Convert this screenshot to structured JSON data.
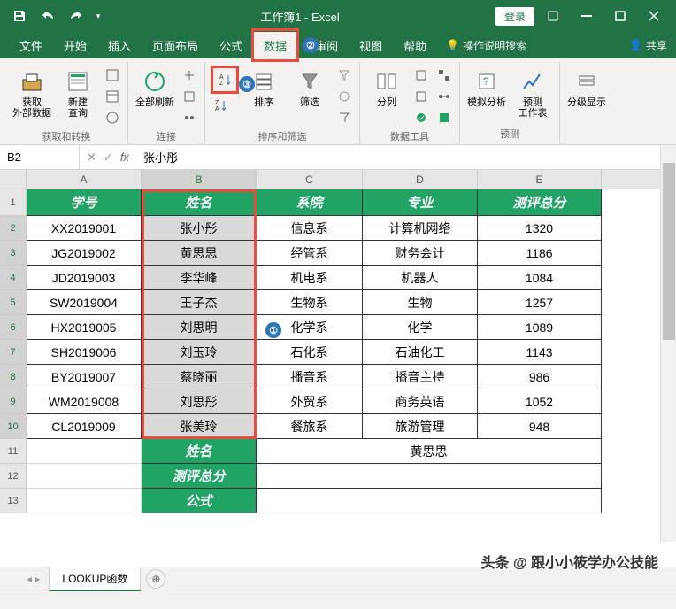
{
  "title": "工作簿1 - Excel",
  "login": "登录",
  "share": "共享",
  "tell_me": "操作说明搜索",
  "tabs": [
    "文件",
    "开始",
    "插入",
    "页面布局",
    "公式",
    "数据",
    "审阅",
    "视图",
    "帮助"
  ],
  "active_tab": 5,
  "annotations": {
    "1": "①",
    "2": "②",
    "3": "③"
  },
  "ribbon_groups": {
    "g1": {
      "btn1": "获取\n外部数据",
      "label": "获取和转换",
      "btn2": "新建\n查询"
    },
    "g2": {
      "btn": "全部刷新",
      "label": "连接"
    },
    "g3": {
      "btn_sort": "排序",
      "btn_filter": "筛选",
      "label": "排序和筛选"
    },
    "g4": {
      "btn": "分列",
      "label": "数据工具"
    },
    "g5": {
      "btn1": "模拟分析",
      "btn2": "预测\n工作表",
      "label": "预测"
    },
    "g6": {
      "btn": "分级显示",
      "label": ""
    }
  },
  "name_box": "B2",
  "formula_value": "张小彤",
  "columns": [
    "A",
    "B",
    "C",
    "D",
    "E"
  ],
  "headers": [
    "学号",
    "姓名",
    "系院",
    "专业",
    "测评总分"
  ],
  "rows": [
    {
      "n": "1"
    },
    {
      "n": "2",
      "d": [
        "XX2019001",
        "张小彤",
        "信息系",
        "计算机网络",
        "1320"
      ]
    },
    {
      "n": "3",
      "d": [
        "JG2019002",
        "黄思思",
        "经管系",
        "财务会计",
        "1186"
      ]
    },
    {
      "n": "4",
      "d": [
        "JD2019003",
        "李华峰",
        "机电系",
        "机器人",
        "1084"
      ]
    },
    {
      "n": "5",
      "d": [
        "SW2019004",
        "王子杰",
        "生物系",
        "生物",
        "1257"
      ]
    },
    {
      "n": "6",
      "d": [
        "HX2019005",
        "刘思明",
        "化学系",
        "化学",
        "1089"
      ]
    },
    {
      "n": "7",
      "d": [
        "SH2019006",
        "刘玉玲",
        "石化系",
        "石油化工",
        "1143"
      ]
    },
    {
      "n": "8",
      "d": [
        "BY2019007",
        "蔡晓丽",
        "播音系",
        "播音主持",
        "986"
      ]
    },
    {
      "n": "9",
      "d": [
        "WM2019008",
        "刘思彤",
        "外贸系",
        "商务英语",
        "1052"
      ]
    },
    {
      "n": "10",
      "d": [
        "CL2019009",
        "张美玲",
        "餐旅系",
        "旅游管理",
        "948"
      ]
    }
  ],
  "lookup_rows": [
    {
      "n": "11",
      "lbl": "姓名",
      "val": "黄思思"
    },
    {
      "n": "12",
      "lbl": "测评总分",
      "val": ""
    },
    {
      "n": "13",
      "lbl": "公式",
      "val": ""
    }
  ],
  "sheet_tab": "LOOKUP函数",
  "watermark": "头条 @ 跟小小筱学办公技能"
}
